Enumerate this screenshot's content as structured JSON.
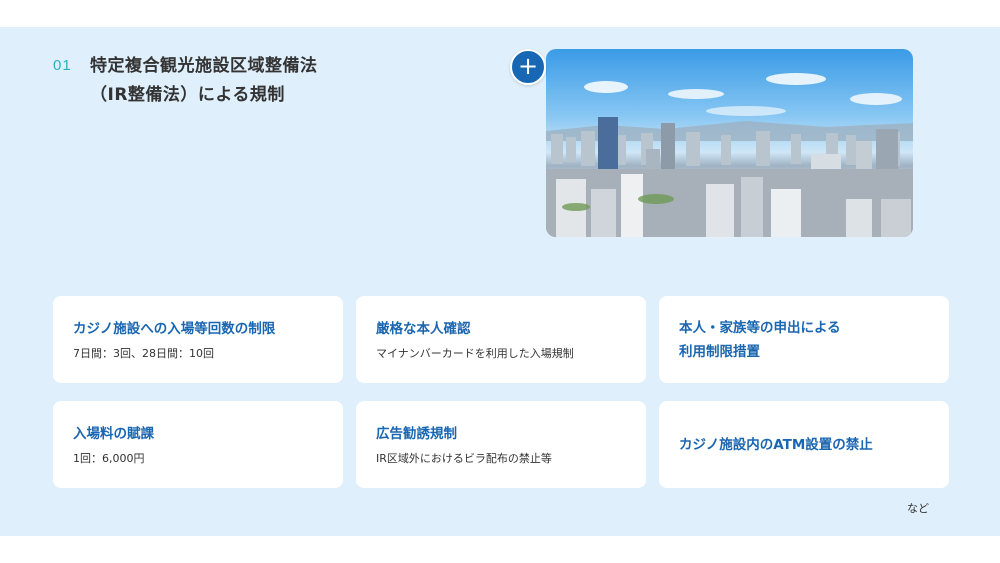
{
  "section": {
    "number": "01",
    "title_line1": "特定複合観光施設区域整備法",
    "title_line2": "（IR整備法）による規制"
  },
  "photo": {
    "icon": "plus-icon"
  },
  "cards": [
    {
      "title": "カジノ施設への入場等回数の制限",
      "sub": "7日間：3回、28日間：10回"
    },
    {
      "title": "厳格な本人確認",
      "sub": "マイナンバーカードを利用した入場規制"
    },
    {
      "title_line1": "本人・家族等の申出による",
      "title_line2": "利用制限措置"
    },
    {
      "title": "入場料の賦課",
      "sub": "1回：6,000円"
    },
    {
      "title": "広告勧誘規制",
      "sub": "IR区域外におけるビラ配布の禁止等"
    },
    {
      "title": "カジノ施設内のATM設置の禁止"
    }
  ],
  "note": "など",
  "colors": {
    "accent": "#1767b4",
    "number": "#2ab3c4",
    "panel": "#dfeffb"
  }
}
